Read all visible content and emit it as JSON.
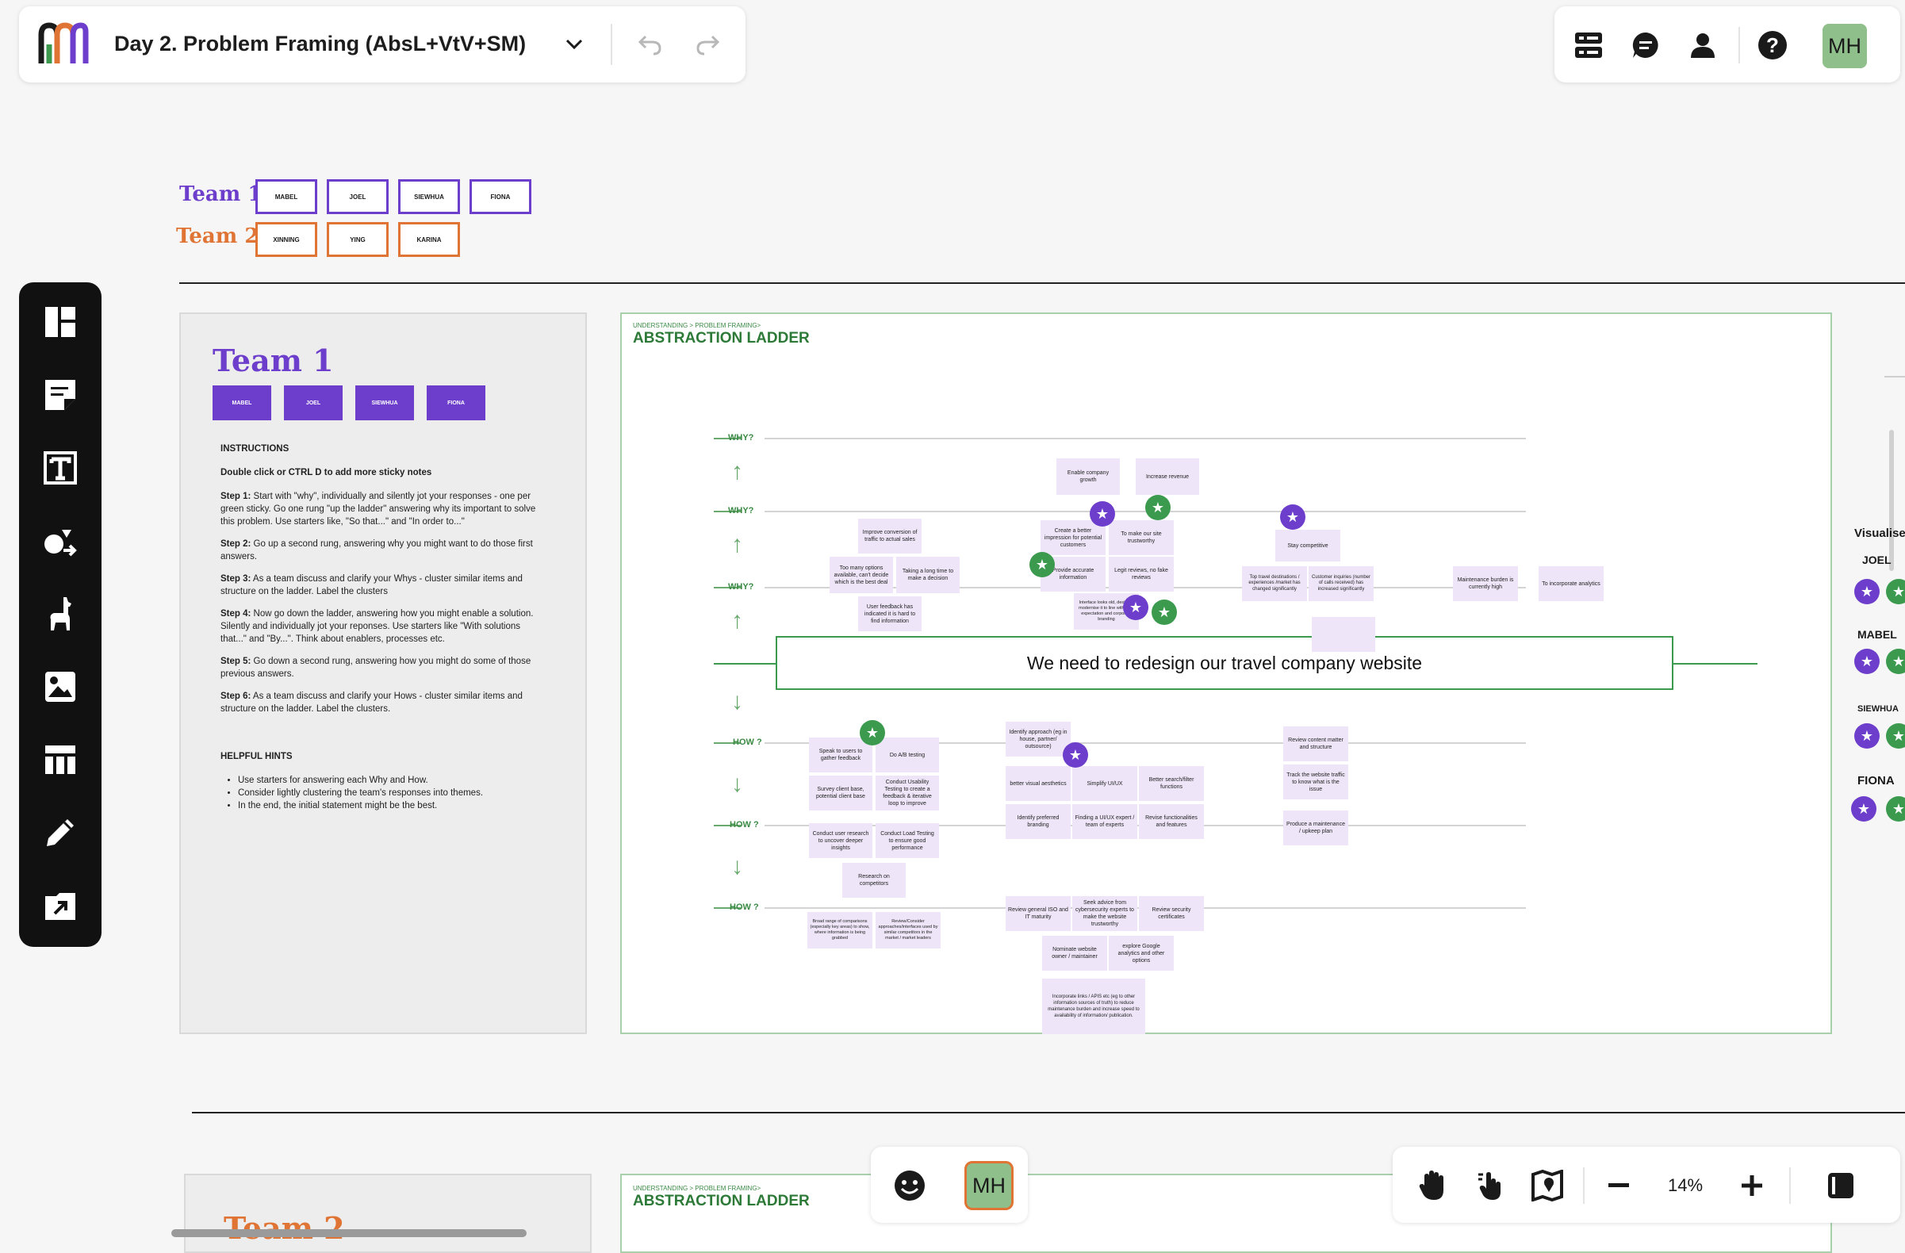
{
  "header": {
    "board_title": "Day 2. Problem Framing (AbsL+VtV+SM)",
    "avatar_initials": "MH"
  },
  "icons": {
    "logo": "miro-style-logo",
    "chevron": "chevron-down-icon",
    "undo": "undo-icon",
    "redo": "redo-icon"
  },
  "legend": {
    "team1_label": "Team 1",
    "team2_label": "Team 2",
    "team1_members": [
      "MABEL",
      "JOEL",
      "SIEWHUA",
      "FIONA"
    ],
    "team2_members": [
      "XINNING",
      "YING",
      "KARINA"
    ]
  },
  "instructions": {
    "team_title": "Team 1",
    "members": [
      "MABEL",
      "JOEL",
      "SIEWHUA",
      "FIONA"
    ],
    "heading": "INSTRUCTIONS",
    "subheading": "Double click or CTRL D to add more sticky notes",
    "steps": [
      {
        "label": "Step 1:",
        "text": "Start with \"why\", individually and silently jot your responses - one per green sticky. Go one rung \"up the ladder\" answering why its important to solve this problem. Use starters like, \"So that...\" and \"In order to...\""
      },
      {
        "label": "Step 2:",
        "text": "Go up a second rung, answering why you might want to do those first answers."
      },
      {
        "label": "Step 3:",
        "text": "As a team discuss and clarify your Whys - cluster similar items and structure on the ladder. Label the clusters"
      },
      {
        "label": "Step 4:",
        "text": "Now go down the ladder, answering how you might enable a solution. Silently and individually jot your reponses. Use starters like \"With solutions that...\" and \"By...\". Think about enablers, processes etc."
      },
      {
        "label": "Step 5:",
        "text": "Go down a second rung, answering how you might do some of those previous answers."
      },
      {
        "label": "Step 6:",
        "text": "As a team discuss and clarify your Hows - cluster similar items and structure on the ladder. Label the clusters."
      }
    ],
    "hints_heading": "HELPFUL HINTS",
    "hints": [
      "Use starters for answering each Why and How.",
      "Consider lightly clustering the team's responses into themes.",
      "In the end, the initial statement might be the best."
    ]
  },
  "ladder": {
    "breadcrumb": "UNDERSTANDING > PROBLEM FRAMING>",
    "title": "ABSTRACTION LADDER",
    "why_label": "WHY?",
    "how_label": "HOW ?",
    "statement": "We need to redesign our travel company website",
    "stickies": [
      "Enable company growth",
      "Increase revenue",
      "Improve conversion of traffic to actual sales",
      "Too many options available, can't decide which is the best deal",
      "Taking a long time to make a decision",
      "User feedback has indicated it is hard to find information",
      "Create a better impression for potential customers",
      "To make our site trustworthy",
      "Provide accurate information",
      "Legit reviews, no fake reviews",
      "Interface looks old, desire to modernise it to line with user expectation and corporate branding",
      "Stay competitive",
      "Top travel destinations / experiences /market has changed significantly",
      "Customer inquiries (number of calls received) has increased significantly",
      "Maintenance burden is currently high",
      "To incorporate analytics",
      "Speak to users to gather feedback",
      "Do A/B testing",
      "Survey client base, potential client base",
      "Conduct Usability Testing to create a feedback & iterative loop to improve",
      "Conduct user research to uncover deeper insights",
      "Conduct Load Testing to ensure good performance",
      "Research on competitors",
      "Broad range of comparisons (especially key areas) to show, where information is being grabbed",
      "Review/Consider approaches/interfaces used by similar competitors in the market / market leaders",
      "Identify approach (eg in house, partner/ outsource)",
      "better visual aesthetics",
      "Simplify UI/UX",
      "Better search/filter functions",
      "Identify preferred branding",
      "Finding a UI/UX expert / team of experts",
      "Revise functionalities and features",
      "Review content matter and structure",
      "Track the website traffic to know what is the issue",
      "Produce a maintenance / upkeep plan",
      "Review general ISO and IT maturity",
      "Seek advice from cybersecurity experts to make the website trustworthy",
      "Review security certificates",
      "Nominate website owner / maintainer",
      "explore Google analytics and other options",
      "Incorporate links / APIS etc (eg to other information sources of truth) to reduce maintenance burden and increase speed to availability of information/ publication."
    ]
  },
  "right_panel": {
    "heading": "Visualise",
    "names": [
      "JOEL",
      "MABEL",
      "SIEWHUA",
      "FIONA"
    ]
  },
  "lower": {
    "team_title": "Team 2",
    "breadcrumb": "UNDERSTANDING > PROBLEM FRAMING>",
    "title": "ABSTRACTION LADDER"
  },
  "bottom_bar": {
    "zoom": "14%",
    "avatar_initials": "MH"
  },
  "colors": {
    "team1": "#6d3ecb",
    "team2": "#e07434",
    "ladder_green": "#3a8a44",
    "sticky": "#eee6f8"
  }
}
